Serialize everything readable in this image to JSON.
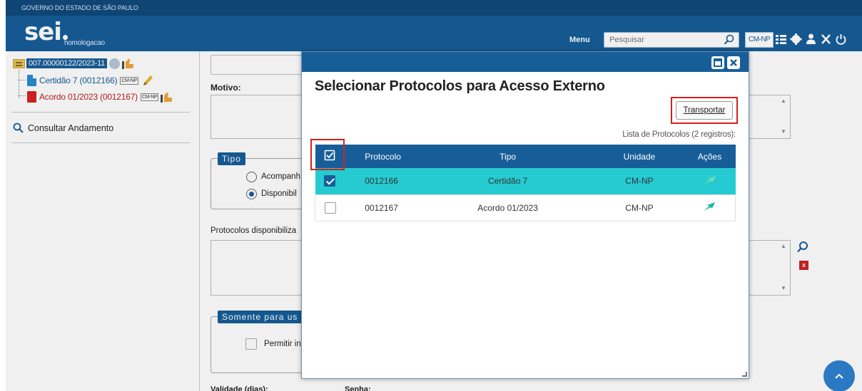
{
  "header": {
    "gov_label": "GOVERNO DO ESTADO DE SÃO PAULO",
    "logo": "sei",
    "environment": "homologacao",
    "menu_label": "Menu",
    "search_placeholder": "Pesquisar",
    "unit_badge": "CM-NP"
  },
  "tree": {
    "process_number": "007.00000122/2023-11",
    "documents": [
      {
        "label": "Certidão 7 (0012166)",
        "badge": "CM-NP"
      },
      {
        "label": "Acordo 01/2023 (0012167)",
        "badge": "CM-NP"
      }
    ],
    "consult_label": "Consultar Andamento"
  },
  "form": {
    "motivo_label": "Motivo:",
    "tipo_legend": "Tipo",
    "radio_options": [
      "Acompanh",
      "Disponibil"
    ],
    "protocolos_label": "Protocolos disponibiliza",
    "somente_legend": "Somente para us",
    "permitir_label": "Permitir in",
    "validade_label": "Validade (dias):",
    "senha_label": "Senha:"
  },
  "modal": {
    "title": "Selecionar Protocolos para Acesso Externo",
    "transport_button": "Transportar",
    "caption": "Lista de Protocolos (2 registros):",
    "columns": [
      "Protocolo",
      "Tipo",
      "Unidade",
      "Ações"
    ],
    "rows": [
      {
        "protocolo": "0012166",
        "tipo": "Certidão 7",
        "unidade": "CM-NP",
        "checked": true
      },
      {
        "protocolo": "0012167",
        "tipo": "Acordo 01/2023",
        "unidade": "CM-NP",
        "checked": false
      }
    ]
  },
  "colors": {
    "primary": "#175e99",
    "selected_row": "#26cbd1",
    "highlight": "#d3211d"
  }
}
